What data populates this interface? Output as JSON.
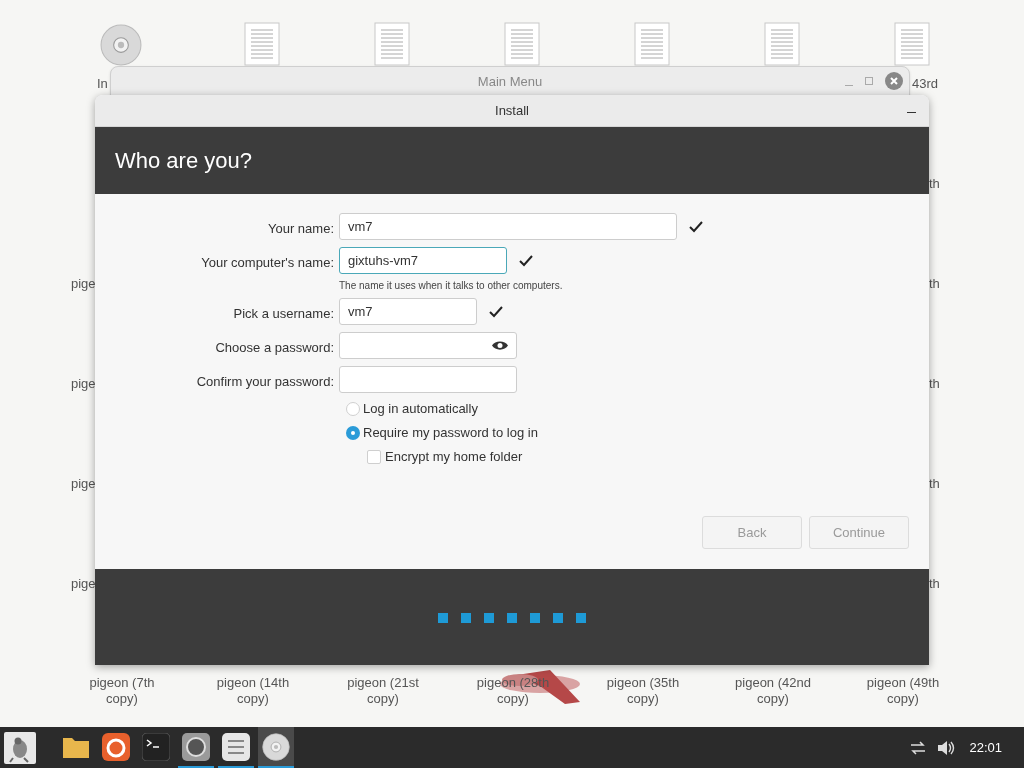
{
  "desktop": {
    "top_labels": [
      {
        "text": "In",
        "kind": "disc"
      },
      {
        "text": "43rd",
        "kind": "document"
      }
    ],
    "side_labels_left": [
      "pige",
      "pige",
      "pige",
      "pige"
    ],
    "side_labels_right": [
      "th",
      "th",
      "th",
      "th",
      "th"
    ],
    "bottom_labels": [
      "pigeon (7th copy)",
      "pigeon (14th copy)",
      "pigeon (21st copy)",
      "pigeon (28th copy)",
      "pigeon (35th copy)",
      "pigeon (42nd copy)",
      "pigeon (49th copy)"
    ]
  },
  "main_menu_window": {
    "title": "Main Menu"
  },
  "install_window": {
    "title": "Install",
    "heading": "Who are you?",
    "fields": [
      {
        "kind": "text",
        "label": "Your name:",
        "value": "vm7",
        "valid": true,
        "focused": false
      },
      {
        "kind": "text",
        "label": "Your computer's name:",
        "value": "gixtuhs-vm7",
        "valid": true,
        "focused": true,
        "hint": "The name it uses when it talks to other computers."
      },
      {
        "kind": "text",
        "label": "Pick a username:",
        "value": "vm7",
        "valid": true,
        "focused": false
      },
      {
        "kind": "password",
        "label": "Choose a password:",
        "valid": false,
        "focused": false
      },
      {
        "kind": "confirm",
        "label": "Confirm your password:",
        "valid": false,
        "focused": false
      }
    ],
    "login_options": [
      {
        "label": "Log in automatically",
        "selected": false
      },
      {
        "label": "Require my password to log in",
        "selected": true
      }
    ],
    "encrypt": {
      "label": "Encrypt my home folder",
      "checked": false
    },
    "buttons": [
      {
        "label": "Back",
        "disabled": true
      },
      {
        "label": "Continue",
        "disabled": true
      }
    ],
    "steps": [
      {
        "done": true
      },
      {
        "done": true
      },
      {
        "done": true
      },
      {
        "done": true
      },
      {
        "done": true
      },
      {
        "done": true
      },
      {
        "done": true
      }
    ]
  },
  "taskbar": {
    "apps": [
      {
        "kind": "folder",
        "running": false,
        "active": false
      },
      {
        "kind": "browser",
        "running": false,
        "active": false
      },
      {
        "kind": "terminal",
        "running": false,
        "active": false
      },
      {
        "kind": "chat",
        "running": true,
        "active": false
      },
      {
        "kind": "list",
        "running": true,
        "active": false
      },
      {
        "kind": "disc",
        "running": true,
        "active": true
      }
    ],
    "clock": "22:01"
  }
}
